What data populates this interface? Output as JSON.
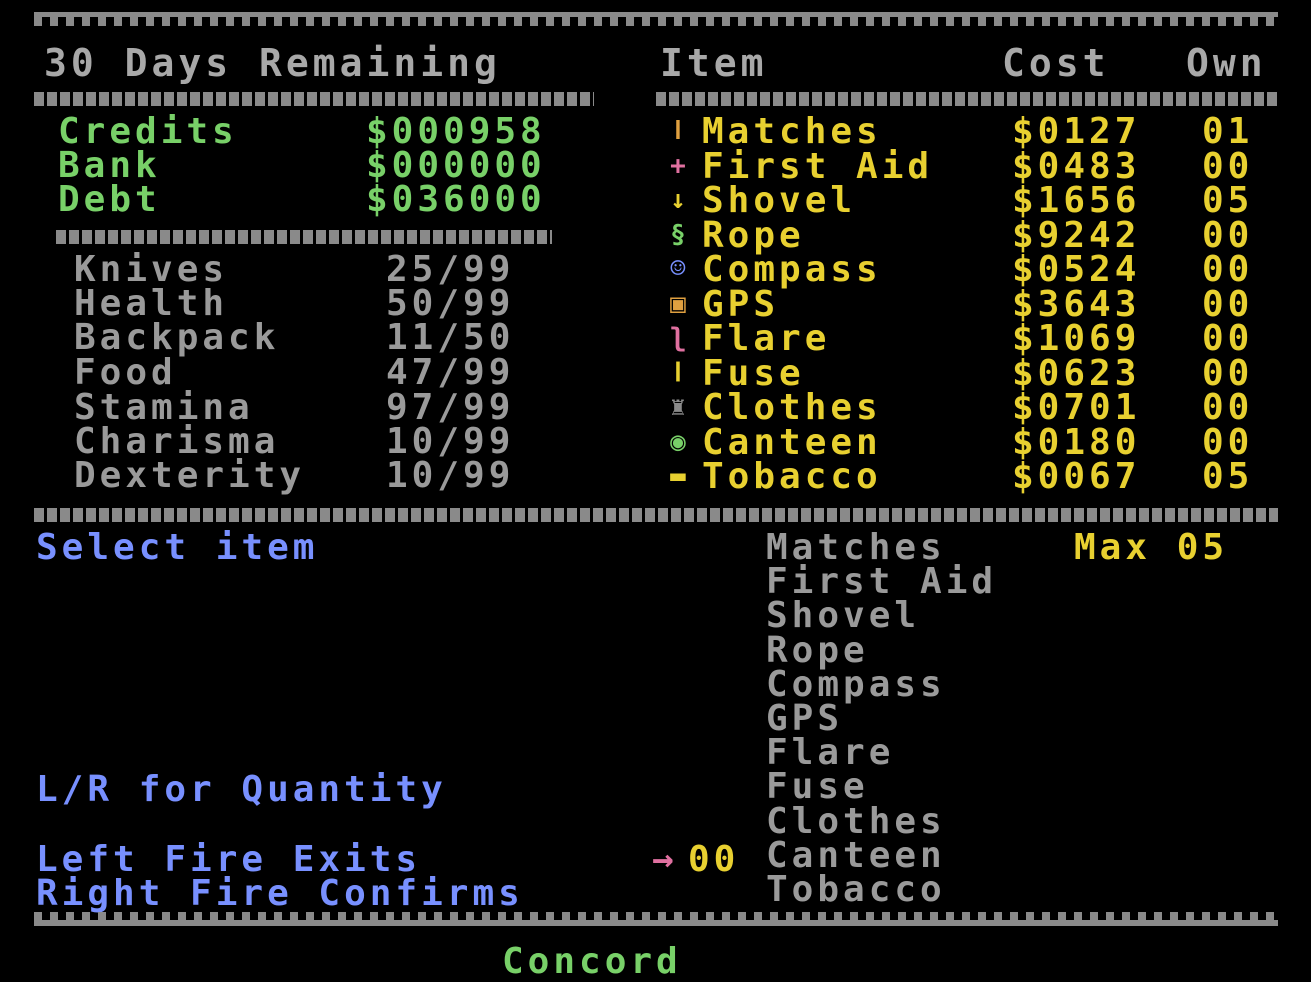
{
  "header": {
    "days_remaining": "30 Days Remaining",
    "col_item": "Item",
    "col_cost": "Cost",
    "col_own": "Own"
  },
  "finances": [
    {
      "label": "Credits",
      "value": "$000958"
    },
    {
      "label": "Bank",
      "value": "$000000"
    },
    {
      "label": "Debt",
      "value": "$036000"
    }
  ],
  "stats": [
    {
      "label": "Knives",
      "value": "25/99"
    },
    {
      "label": "Health",
      "value": "50/99"
    },
    {
      "label": "Backpack",
      "value": "11/50"
    },
    {
      "label": "Food",
      "value": "47/99"
    },
    {
      "label": "Stamina",
      "value": "97/99"
    },
    {
      "label": "Charisma",
      "value": "10/99"
    },
    {
      "label": "Dexterity",
      "value": "10/99"
    }
  ],
  "shop": [
    {
      "icon": "match-icon",
      "glyph": "ǀ",
      "color": "#e0a040",
      "name": "Matches",
      "cost": "$0127",
      "own": "01"
    },
    {
      "icon": "first-aid-icon",
      "glyph": "+",
      "color": "#e070a0",
      "name": "First Aid",
      "cost": "$0483",
      "own": "00"
    },
    {
      "icon": "shovel-icon",
      "glyph": "↓",
      "color": "#e8d030",
      "name": "Shovel",
      "cost": "$1656",
      "own": "05"
    },
    {
      "icon": "rope-icon",
      "glyph": "§",
      "color": "#78d068",
      "name": "Rope",
      "cost": "$9242",
      "own": "00"
    },
    {
      "icon": "compass-icon",
      "glyph": "☺",
      "color": "#7890ff",
      "name": "Compass",
      "cost": "$0524",
      "own": "00"
    },
    {
      "icon": "gps-icon",
      "glyph": "▣",
      "color": "#e0a040",
      "name": "GPS",
      "cost": "$3643",
      "own": "00"
    },
    {
      "icon": "flare-icon",
      "glyph": "ʅ",
      "color": "#e070a0",
      "name": "Flare",
      "cost": "$1069",
      "own": "00"
    },
    {
      "icon": "fuse-icon",
      "glyph": "Ⅰ",
      "color": "#e8d030",
      "name": "Fuse",
      "cost": "$0623",
      "own": "00"
    },
    {
      "icon": "clothes-icon",
      "glyph": "♜",
      "color": "#8a8a8a",
      "name": "Clothes",
      "cost": "$0701",
      "own": "00"
    },
    {
      "icon": "canteen-icon",
      "glyph": "◉",
      "color": "#78d068",
      "name": "Canteen",
      "cost": "$0180",
      "own": "00"
    },
    {
      "icon": "tobacco-icon",
      "glyph": "▬",
      "color": "#e8d030",
      "name": "Tobacco",
      "cost": "$0067",
      "own": "05"
    }
  ],
  "prompt": {
    "select_item": "Select item",
    "quantity_hint": "L/R for Quantity",
    "left_fire": "Left Fire Exits",
    "right_fire": "Right Fire Confirms",
    "max_label": "Max 05",
    "quantity_value": "00",
    "cursor_glyph": "→"
  },
  "select_list": [
    "Matches",
    "First Aid",
    "Shovel",
    "Rope",
    "Compass",
    "GPS",
    "Flare",
    "Fuse",
    "Clothes",
    "Canteen",
    "Tobacco"
  ],
  "location": "Concord"
}
